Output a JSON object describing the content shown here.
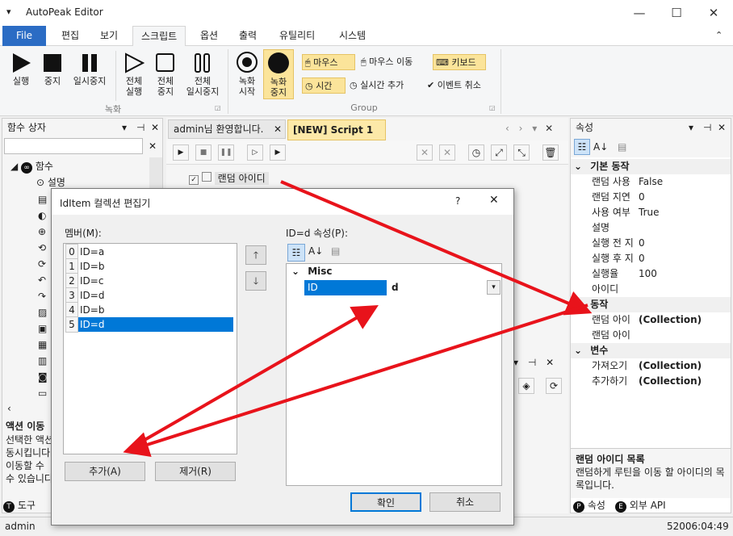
{
  "app": {
    "title": "AutoPeak Editor",
    "status_user": "admin",
    "status_time": "52006:04:49"
  },
  "window_controls": {
    "minimize": "—",
    "maximize": "☐",
    "close": "✕"
  },
  "menu": [
    "File",
    "편집",
    "보기",
    "스크립트",
    "옵션",
    "출력",
    "유틸리티",
    "시스템"
  ],
  "ribbon": {
    "record_group": {
      "label": "녹화",
      "run": "실행",
      "stop": "중지",
      "pause": "일시중지",
      "run_all_1": "전체",
      "run_all_2": "실행",
      "stop_all_1": "전체",
      "stop_all_2": "중지",
      "pause_all_1": "전체",
      "pause_all_2": "일시중지"
    },
    "group2": {
      "label": "Group",
      "rec_start_1": "녹화",
      "rec_start_2": "시작",
      "rec_stop_1": "녹화",
      "rec_stop_2": "중지",
      "mouse": "마우스",
      "mouse_move": "마우스 이동",
      "keyboard": "키보드",
      "time": "시간",
      "realtime_add": "실시간 추가",
      "event_cancel": "이벤트 취소"
    }
  },
  "left_panel": {
    "title": "함수 상자",
    "tree_root": "함수",
    "tree_first": "설명",
    "desc_title": "액션 이동",
    "desc_lines": [
      "선택한 액션",
      "동시킵니다",
      "이동할 수",
      "수 있습니다"
    ],
    "tabs": [
      "도구",
      ""
    ]
  },
  "doc_tabs": [
    "admin님 환영합니다.",
    "[NEW] Script 1"
  ],
  "script_item": "랜덤 아이디",
  "properties": {
    "title": "속성",
    "sections": [
      {
        "name": "기본 동작",
        "rows": [
          [
            "랜덤 사용",
            "False"
          ],
          [
            "랜덤 지연",
            "0"
          ],
          [
            "사용 여부",
            "True"
          ],
          [
            "설명",
            ""
          ],
          [
            "실행 전 지",
            "0"
          ],
          [
            "실행 후 지",
            "0"
          ],
          [
            "실행율",
            "100"
          ],
          [
            "아이디",
            ""
          ]
        ]
      },
      {
        "name": "동작",
        "rows": [
          [
            "랜덤 아이",
            "(Collection)"
          ],
          [
            "랜덤 아이",
            ""
          ]
        ]
      },
      {
        "name": "변수",
        "rows": [
          [
            "가져오기",
            "(Collection)"
          ],
          [
            "추가하기",
            "(Collection)"
          ]
        ]
      }
    ],
    "desc_title": "랜덤 아이디 목록",
    "desc_text": "랜덤하게 루틴을 이동 할 아이디의 목록입니다.",
    "tabs": [
      "속성",
      "외부 API"
    ]
  },
  "dialog": {
    "title": "IdItem 컬렉션 편집기",
    "help": "?",
    "members_label": "멤버(M):",
    "members": [
      {
        "index": "0",
        "text": "ID=a"
      },
      {
        "index": "1",
        "text": "ID=b"
      },
      {
        "index": "2",
        "text": "ID=c"
      },
      {
        "index": "3",
        "text": "ID=d"
      },
      {
        "index": "4",
        "text": "ID=b"
      },
      {
        "index": "5",
        "text": "ID=d"
      }
    ],
    "props_label": "ID=d 속성(P):",
    "category": "Misc",
    "prop_name": "ID",
    "prop_value": "d",
    "add": "추가(A)",
    "remove": "제거(R)",
    "ok": "확인",
    "cancel": "취소"
  },
  "colors": {
    "accent": "#2b6cc4",
    "selection": "#0078d7",
    "arrow": "#e8131b",
    "highlight": "#fbe49a"
  }
}
